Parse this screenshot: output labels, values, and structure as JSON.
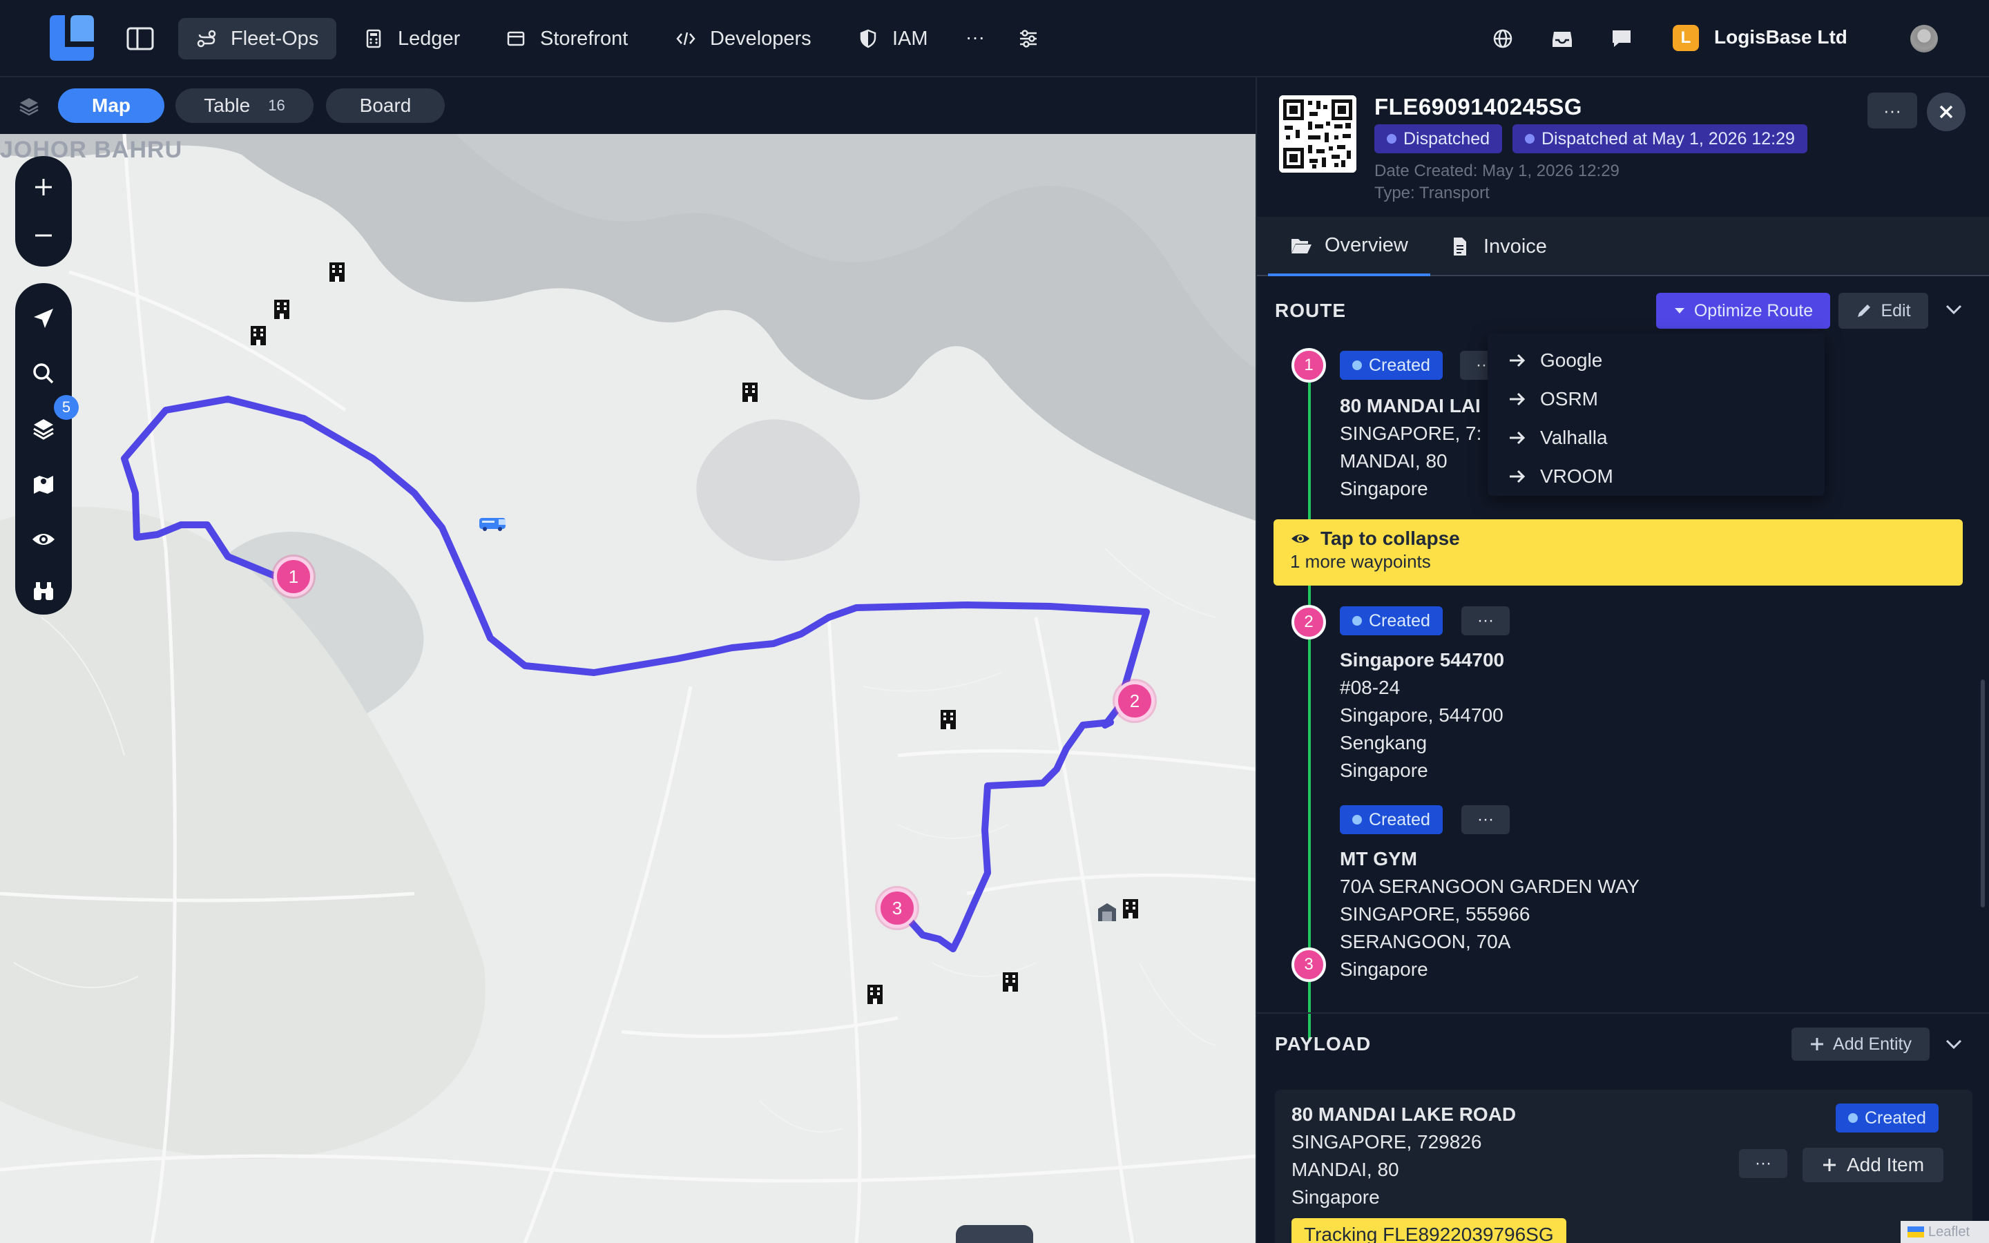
{
  "nav": {
    "items": [
      {
        "label": "Fleet-Ops",
        "icon": "route-icon",
        "active": true
      },
      {
        "label": "Ledger",
        "icon": "calculator-icon"
      },
      {
        "label": "Storefront",
        "icon": "store-icon"
      },
      {
        "label": "Developers",
        "icon": "code-icon"
      },
      {
        "label": "IAM",
        "icon": "shield-icon"
      }
    ],
    "more": "···",
    "org_initial": "L",
    "org_name": "LogisBase Ltd"
  },
  "map_view": {
    "tabs": [
      {
        "label": "Map",
        "active": true
      },
      {
        "label": "Table",
        "count": "16"
      },
      {
        "label": "Board"
      }
    ],
    "area_label": "JOHOR BAHRU",
    "layers_badge": "5",
    "markers": [
      "1",
      "2",
      "3"
    ],
    "attribution": "Leaflet"
  },
  "order": {
    "id": "FLE6909140245SG",
    "status": "Dispatched",
    "dispatched_at": "Dispatched at May 1, 2026 12:29",
    "date_created": "Date Created: May 1, 2026 12:29",
    "type": "Type: Transport",
    "menu": "···"
  },
  "tabs": [
    {
      "label": "Overview",
      "active": true
    },
    {
      "label": "Invoice"
    }
  ],
  "route": {
    "title": "ROUTE",
    "optimize_label": "Optimize Route",
    "edit_label": "Edit",
    "optimize_options": [
      "Google",
      "OSRM",
      "Valhalla",
      "VROOM"
    ],
    "collapse_title": "Tap to collapse",
    "collapse_sub": "1 more waypoints",
    "waypoints": [
      {
        "num": "1",
        "status": "Created",
        "name": "80 MANDAI LAKE ROAD",
        "name_visible": "80 MANDAI LAI",
        "line2": "SINGAPORE, 7:",
        "line3": "MANDAI, 80",
        "line4": "Singapore"
      },
      {
        "num": "2",
        "status": "Created",
        "name": "Singapore 544700",
        "line2": "#08-24",
        "line3": "Singapore, 544700",
        "line4": "Sengkang",
        "line5": "Singapore"
      },
      {
        "num": "",
        "status": "Created",
        "name": "MT GYM",
        "line2": "70A SERANGOON GARDEN WAY",
        "line3": "SINGAPORE, 555966",
        "line4": "SERANGOON, 70A",
        "line5": "Singapore"
      },
      {
        "num": "3"
      }
    ]
  },
  "payload": {
    "title": "PAYLOAD",
    "add_entity": "Add Entity",
    "entity": {
      "name": "80 MANDAI LAKE ROAD",
      "line2": "SINGAPORE, 729826",
      "line3": "MANDAI, 80",
      "line4": "Singapore",
      "status": "Created",
      "add_item": "Add Item",
      "tracking": "Tracking FLE8922039796SG"
    }
  },
  "colors": {
    "route": "#4f46e5",
    "accent": "#3b82f6",
    "marker": "#ec4899",
    "highlight": "#fde047"
  }
}
